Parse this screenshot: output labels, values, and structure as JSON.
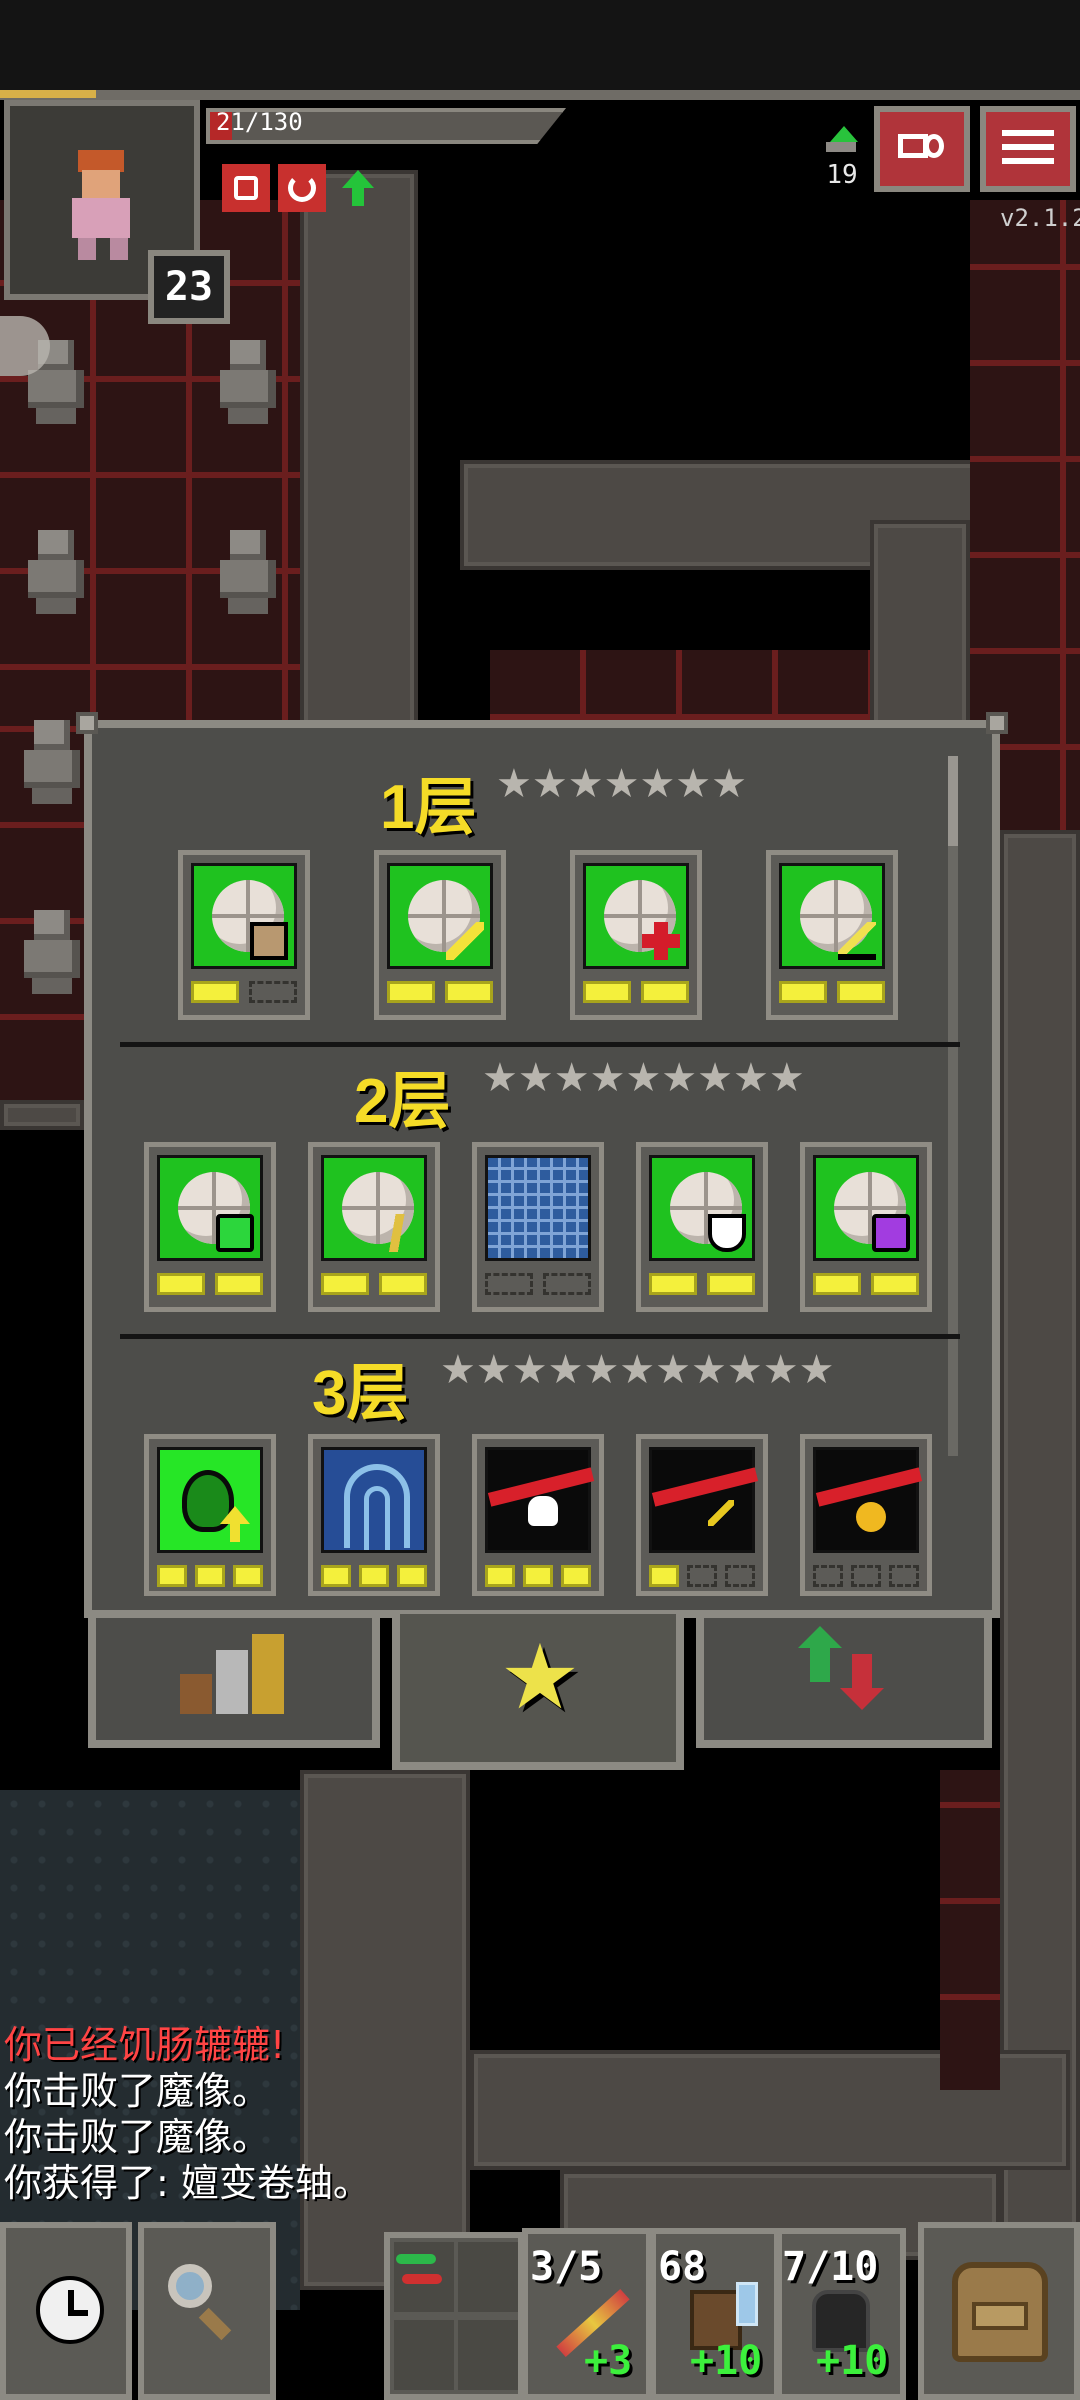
{
  "hud": {
    "hp": "21/130",
    "level": "23",
    "depth": "19",
    "version": "v2.1.2"
  },
  "badges": {
    "tiers": [
      {
        "title": "1层",
        "stars": "★★★★★★★",
        "badges": [
          {
            "tile": "green",
            "emblem": "box",
            "pips": [
              true,
              false
            ]
          },
          {
            "tile": "green",
            "emblem": "wand",
            "pips": [
              true,
              true
            ]
          },
          {
            "tile": "green",
            "emblem": "cross",
            "pips": [
              true,
              true
            ]
          },
          {
            "tile": "green",
            "emblem": "sword",
            "pips": [
              true,
              true
            ]
          }
        ]
      },
      {
        "title": "2层",
        "stars": "★★★★★★★★★",
        "badges": [
          {
            "tile": "green",
            "emblem": "green-potion",
            "pips": [
              true,
              true
            ]
          },
          {
            "tile": "green",
            "emblem": "runner",
            "pips": [
              true,
              true
            ]
          },
          {
            "tile": "blue-grid",
            "emblem": "none",
            "pips": [
              false,
              false
            ]
          },
          {
            "tile": "green",
            "emblem": "shield",
            "pips": [
              true,
              true
            ]
          },
          {
            "tile": "green",
            "emblem": "purple-potion",
            "pips": [
              true,
              true
            ]
          }
        ]
      },
      {
        "title": "3层",
        "stars": "★★★★★★★★★★★",
        "badges": [
          {
            "tile": "bright-green",
            "emblem": "leaf-up",
            "pips": [
              true,
              true,
              true
            ]
          },
          {
            "tile": "navy",
            "emblem": "hood",
            "pips": [
              true,
              true,
              true
            ]
          },
          {
            "tile": "black",
            "emblem": "skull-slash",
            "pips": [
              true,
              true,
              true
            ]
          },
          {
            "tile": "black",
            "emblem": "arrow-slash",
            "pips": [
              true,
              false,
              false
            ]
          },
          {
            "tile": "black",
            "emblem": "gold-slash",
            "pips": [
              false,
              false,
              false
            ]
          }
        ]
      }
    ]
  },
  "log": [
    {
      "text": "你已经饥肠辘辘!",
      "color": "#ff4444"
    },
    {
      "text": "你击败了魔像。",
      "color": "#ffffff"
    },
    {
      "text": "你击败了魔像。",
      "color": "#ffffff"
    },
    {
      "text": "你获得了: 嬗变卷轴。",
      "color": "#ffffff"
    }
  ],
  "quickslots": [
    {
      "top": "3/5",
      "bottom": "+3",
      "icon": "wand-icon"
    },
    {
      "top": "68",
      "bottom": "+10",
      "icon": "crate-icon"
    },
    {
      "top": "7/10",
      "bottom": "+10",
      "icon": "armor-icon"
    }
  ],
  "colors": {
    "tier_title": "#f5dc27",
    "pip_on": "#f4f03c",
    "log_warning": "#ff4444",
    "upgrade_text": "#3cf03c"
  }
}
